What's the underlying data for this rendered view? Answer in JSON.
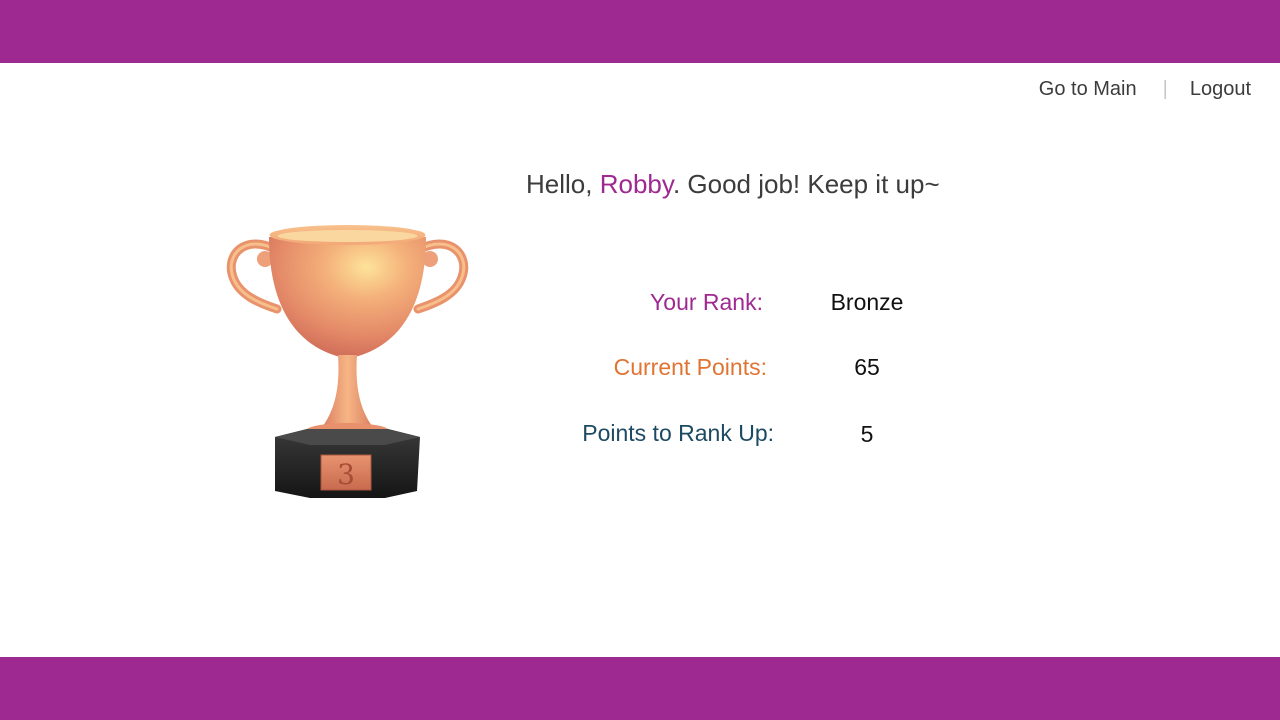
{
  "header": {
    "nav": {
      "go_to_main": "Go to Main",
      "separator": "|",
      "logout": "Logout"
    }
  },
  "greeting": {
    "prefix": "Hello, ",
    "user_name": "Robby",
    "suffix": ". Good job! Keep it up~"
  },
  "trophy": {
    "icon": "bronze-trophy-icon",
    "place_number": "3"
  },
  "stats": {
    "rank_label": "Your Rank:",
    "rank_value": "Bronze",
    "points_label": "Current Points:",
    "points_value": "65",
    "rankup_label": "Points to Rank Up:",
    "rankup_value": "5"
  },
  "colors": {
    "brand": "#9e2a91",
    "points_label": "#e07433",
    "rankup_label": "#1d4a63"
  }
}
